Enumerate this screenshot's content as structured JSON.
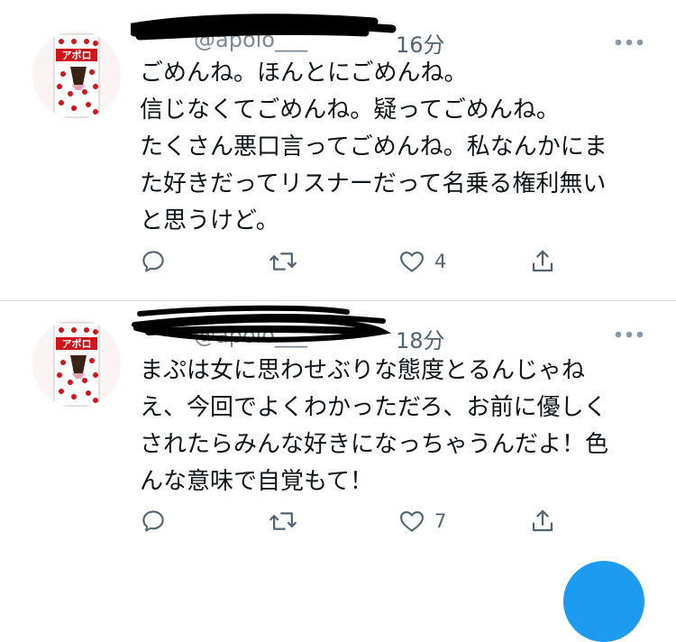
{
  "colors": {
    "accent": "#1d9bf0",
    "text": "#0f1419",
    "secondary": "#536471",
    "divider": "#d9d9d9"
  },
  "tweets": [
    {
      "handle": "@apolo___",
      "time": "16分",
      "avatar_icon": "apollo-chocolate-box-icon",
      "lines": [
        "ごめんね。ほんとにごめんね。",
        "信じなくてごめんね。疑ってごめんね。",
        "たくさん悪口言ってごめんね。私なんかにま",
        "た好きだってリスナーだって名乗る権利無い",
        "と思うけど。"
      ],
      "replies": "",
      "retweets": "",
      "likes": "4"
    },
    {
      "handle": "@apolo___",
      "time": "18分",
      "avatar_icon": "apollo-chocolate-box-icon",
      "lines": [
        "まぷは女に思わせぶりな態度とるんじゃね",
        "え、今回でよくわかっただろ、お前に優しく",
        "されたらみんな好きになっちゃうんだよ！色",
        "んな意味で自覚もて！"
      ],
      "replies": "",
      "retweets": "",
      "likes": "7"
    }
  ]
}
